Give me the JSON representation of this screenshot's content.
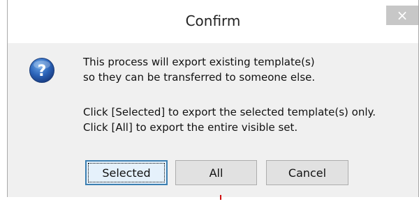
{
  "dialog": {
    "title": "Confirm",
    "close_glyph": "×",
    "icon": "question-icon",
    "message_lines": [
      "This process will export existing template(s)",
      "so they can be transferred to someone else.",
      "Click [Selected] to export the selected template(s) only.",
      "Click [All] to export the entire visible set."
    ],
    "buttons": {
      "selected": "Selected",
      "all": "All",
      "cancel": "Cancel"
    }
  },
  "colors": {
    "window_bg": "#f0f0f0",
    "titlebar_bg": "#ffffff",
    "close_bg": "#c7c7c7",
    "accent": "#3c7fb1",
    "marker": "#d01010"
  }
}
